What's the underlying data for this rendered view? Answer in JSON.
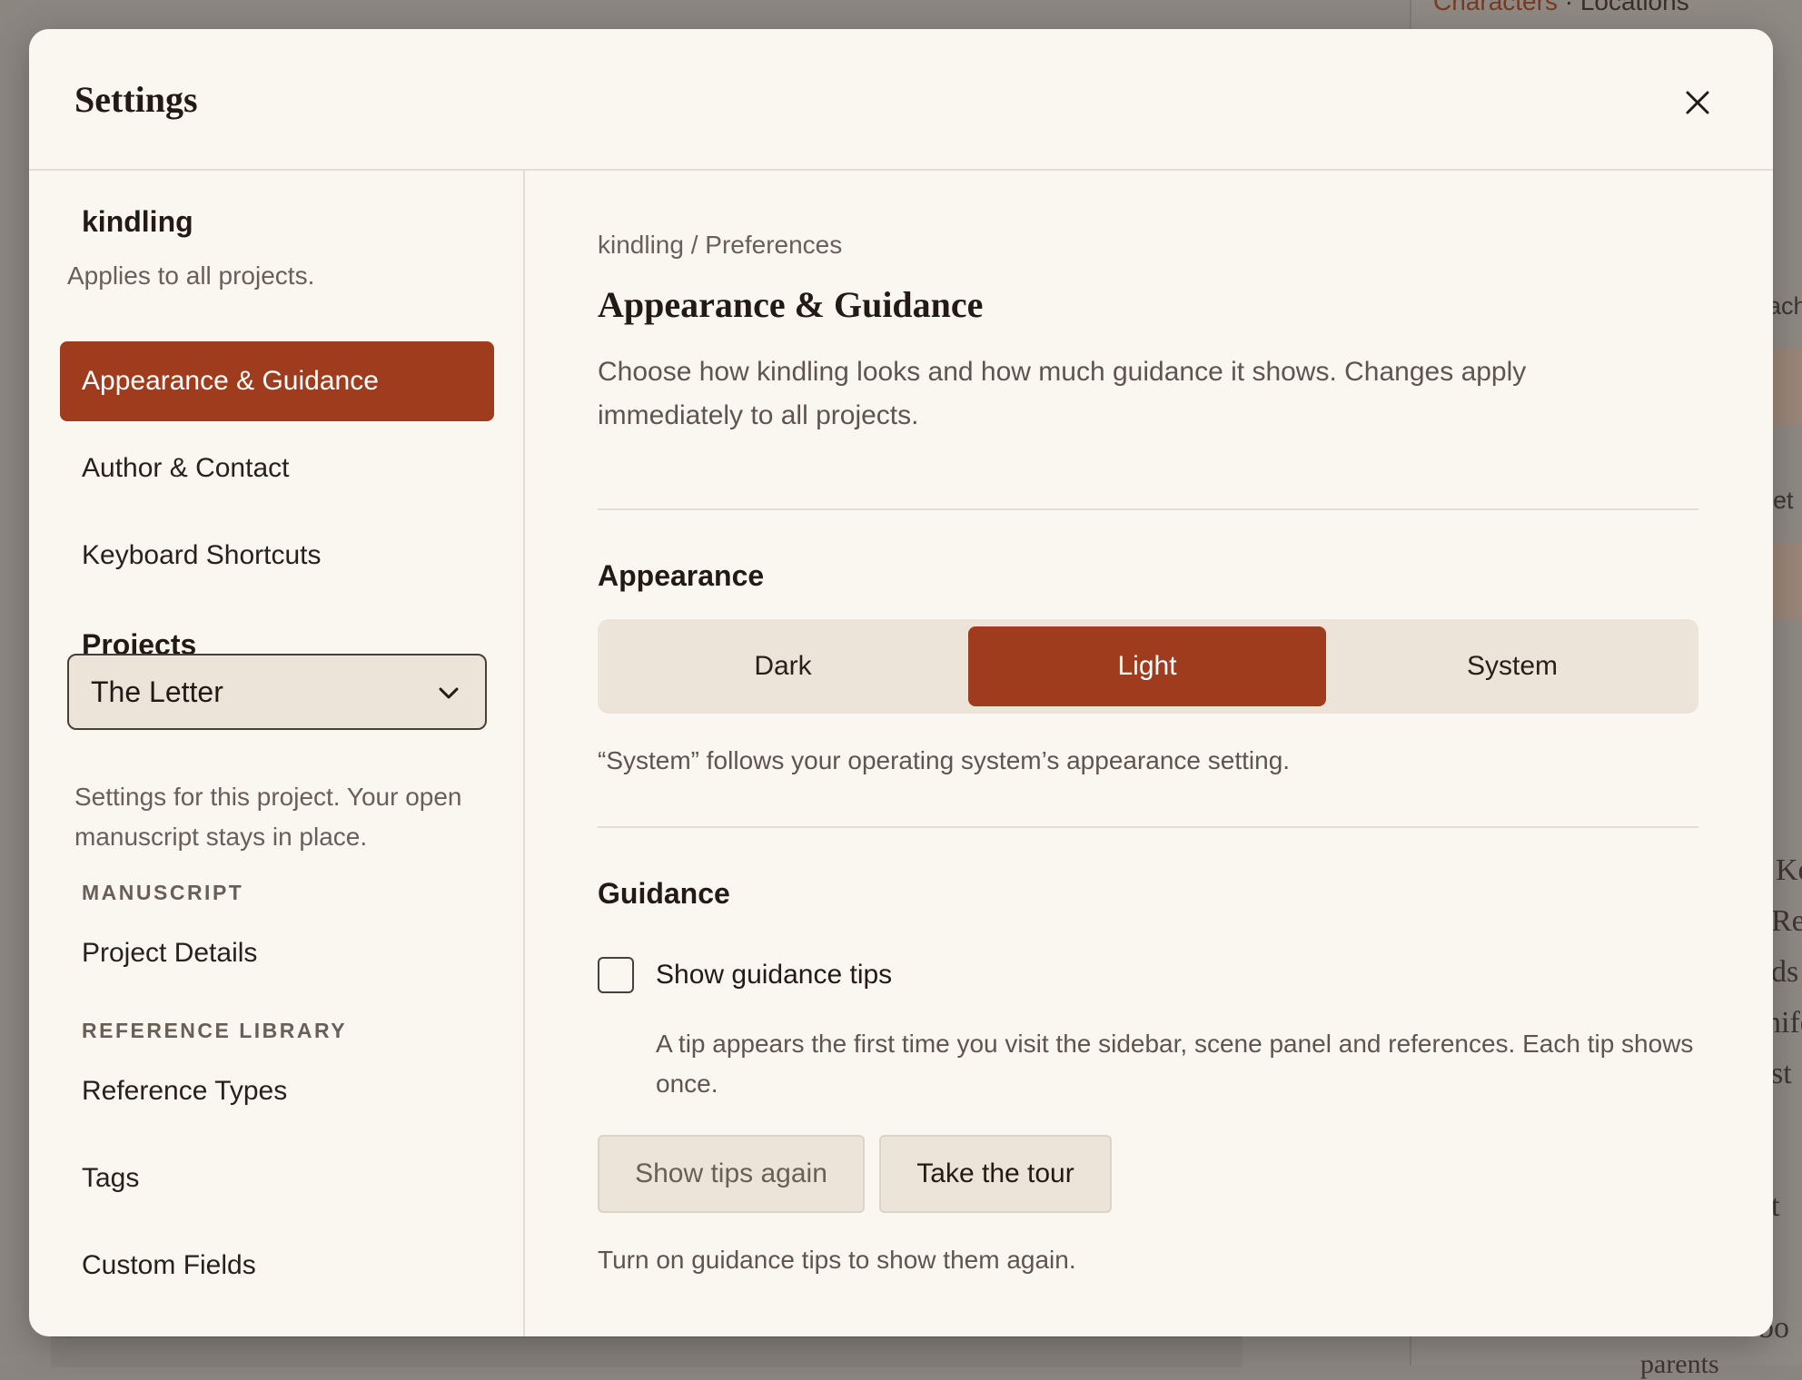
{
  "background": {
    "tabs": {
      "active": "Characters",
      "separator": "·",
      "other": "Locations"
    },
    "fragments": [
      "ach",
      "et",
      "Ke",
      "Re",
      "ds",
      "nife",
      "st",
      "t",
      "bo",
      "parents"
    ]
  },
  "modal": {
    "title": "Settings",
    "close_icon": "close-icon"
  },
  "sidebar": {
    "workspace_name": "kindling",
    "workspace_sub": "Applies to all projects.",
    "global_items": [
      {
        "label": "Appearance & Guidance",
        "active": true
      },
      {
        "label": "Author & Contact",
        "active": false
      },
      {
        "label": "Keyboard Shortcuts",
        "active": false
      }
    ],
    "projects_heading": "Projects",
    "project_select": {
      "value": "The Letter",
      "icon": "chevron-down-icon"
    },
    "project_note": "Settings for this project. Your open manuscript stays in place.",
    "manuscript_label": "MANUSCRIPT",
    "manuscript_items": [
      {
        "label": "Project Details"
      }
    ],
    "reference_label": "REFERENCE LIBRARY",
    "reference_items": [
      {
        "label": "Reference Types"
      },
      {
        "label": "Tags"
      },
      {
        "label": "Custom Fields"
      }
    ]
  },
  "content": {
    "breadcrumb": "kindling / Preferences",
    "title": "Appearance & Guidance",
    "description": "Choose how kindling looks and how much guidance it shows. Changes apply immediately to all projects.",
    "appearance": {
      "heading": "Appearance",
      "options": [
        "Dark",
        "Light",
        "System"
      ],
      "selected": "Light",
      "hint": "“System” follows your operating system’s appearance setting."
    },
    "guidance": {
      "heading": "Guidance",
      "checkbox_label": "Show guidance tips",
      "checked": false,
      "checkbox_desc": "A tip appears the first time you visit the sidebar, scene panel and references. Each tip shows once.",
      "show_tips_button": "Show tips again",
      "tour_button": "Take the tour",
      "footer_hint": "Turn on guidance tips to show them again."
    }
  },
  "colors": {
    "accent": "#a03c1e",
    "modal_bg": "#faf7f1",
    "control_bg": "#ece4d8",
    "text": "#231a15",
    "muted": "#6a5f57",
    "overlay": "#8b8680"
  }
}
